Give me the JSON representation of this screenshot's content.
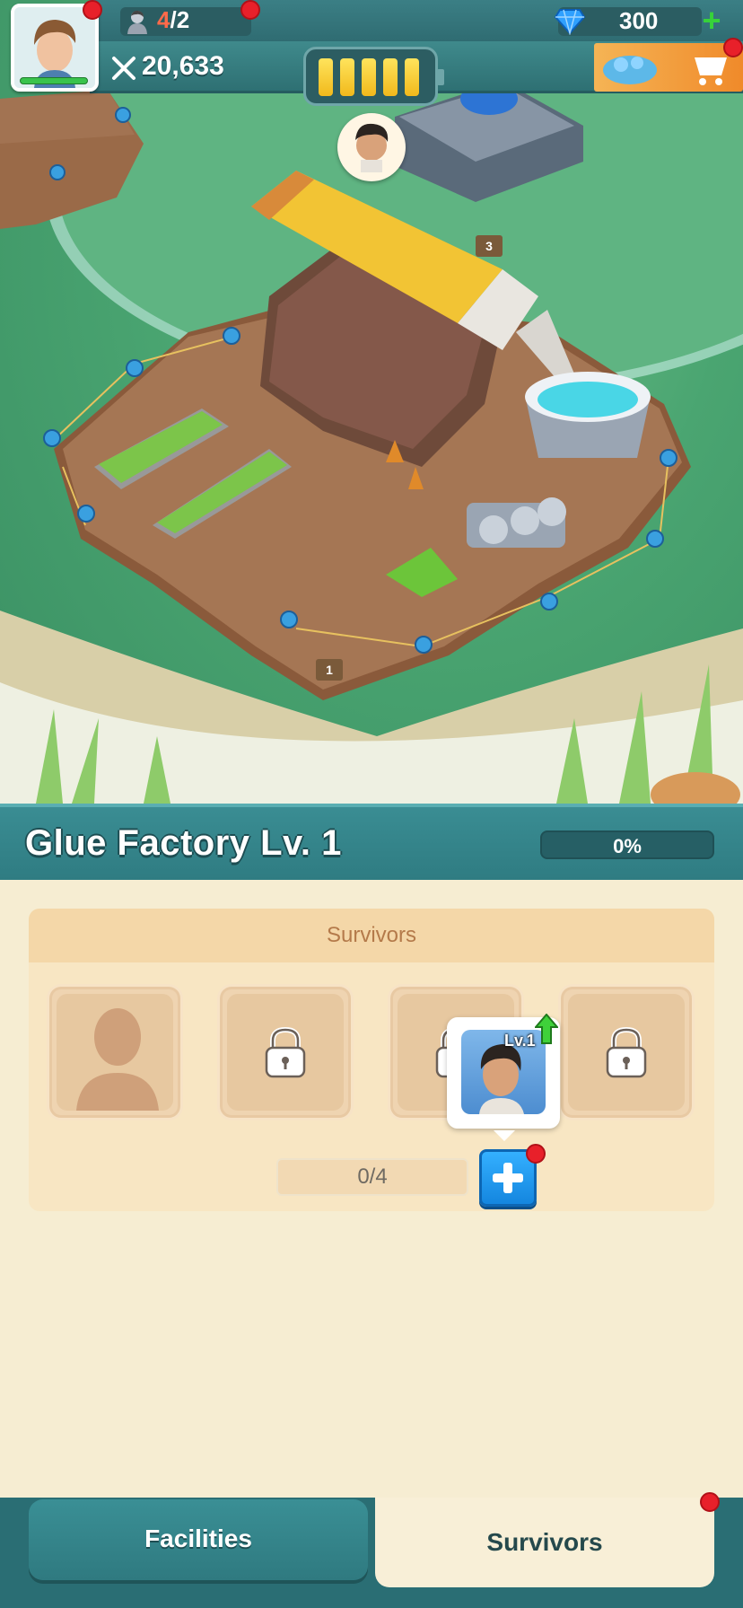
{
  "hud": {
    "population_current": "4",
    "population_max": "/2",
    "power_value": "20,633",
    "battery_level": 1.0,
    "gems_value": "300",
    "icons": [
      "avatar-portrait",
      "survivor-icon",
      "crossed-swords-icon",
      "battery-icon",
      "diamond-icon",
      "plus-icon",
      "shop-cart-icon"
    ]
  },
  "scene": {
    "building_label_3": "3",
    "building_label_1": "1"
  },
  "facility": {
    "title": "Glue Factory Lv. 1",
    "progress_label": "0%",
    "progress_fraction": 0.0
  },
  "survivors_panel": {
    "header": "Survivors",
    "slots": [
      "empty",
      "locked",
      "locked",
      "locked"
    ],
    "counter": "0/4",
    "popup_level": "Lv.1"
  },
  "tabs": {
    "facilities": "Facilities",
    "survivors": "Survivors",
    "active": "survivors"
  },
  "colors": {
    "accent_teal": "#2f7c82",
    "panel_cream": "#f6edd2",
    "notification_red": "#e8202a",
    "action_blue": "#1486df"
  }
}
